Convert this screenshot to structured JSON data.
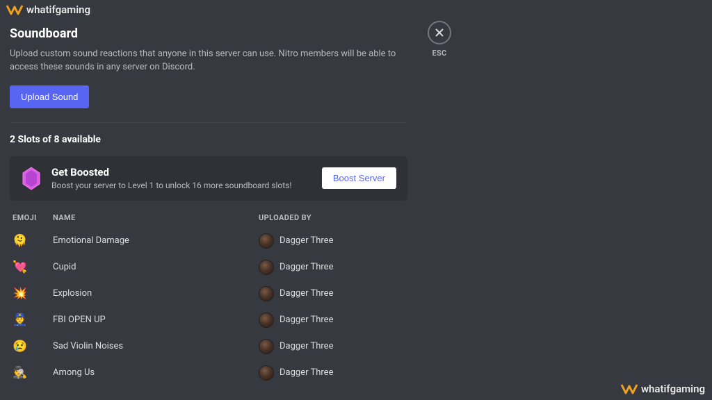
{
  "watermark": {
    "text": "whatifgaming"
  },
  "close": {
    "label": "ESC"
  },
  "header": {
    "title": "Soundboard",
    "description": "Upload custom sound reactions that anyone in this server can use. Nitro members will be able to access these sounds in any server on Discord.",
    "upload_label": "Upload Sound"
  },
  "slots_text": "2 Slots of 8 available",
  "boost": {
    "title": "Get Boosted",
    "subtitle": "Boost your server to Level 1 to unlock 16 more soundboard slots!",
    "button": "Boost Server"
  },
  "columns": {
    "emoji": "EMOJI",
    "name": "NAME",
    "uploader": "UPLOADED BY"
  },
  "sounds": [
    {
      "emoji": "🫠",
      "name": "Emotional Damage",
      "uploader": "Dagger Three"
    },
    {
      "emoji": "💘",
      "name": "Cupid",
      "uploader": "Dagger Three"
    },
    {
      "emoji": "💥",
      "name": "Explosion",
      "uploader": "Dagger Three"
    },
    {
      "emoji": "👮",
      "name": "FBI OPEN UP",
      "uploader": "Dagger Three"
    },
    {
      "emoji": "😢",
      "name": "Sad Violin Noises",
      "uploader": "Dagger Three"
    },
    {
      "emoji": "🕵️",
      "name": "Among Us",
      "uploader": "Dagger Three"
    }
  ]
}
